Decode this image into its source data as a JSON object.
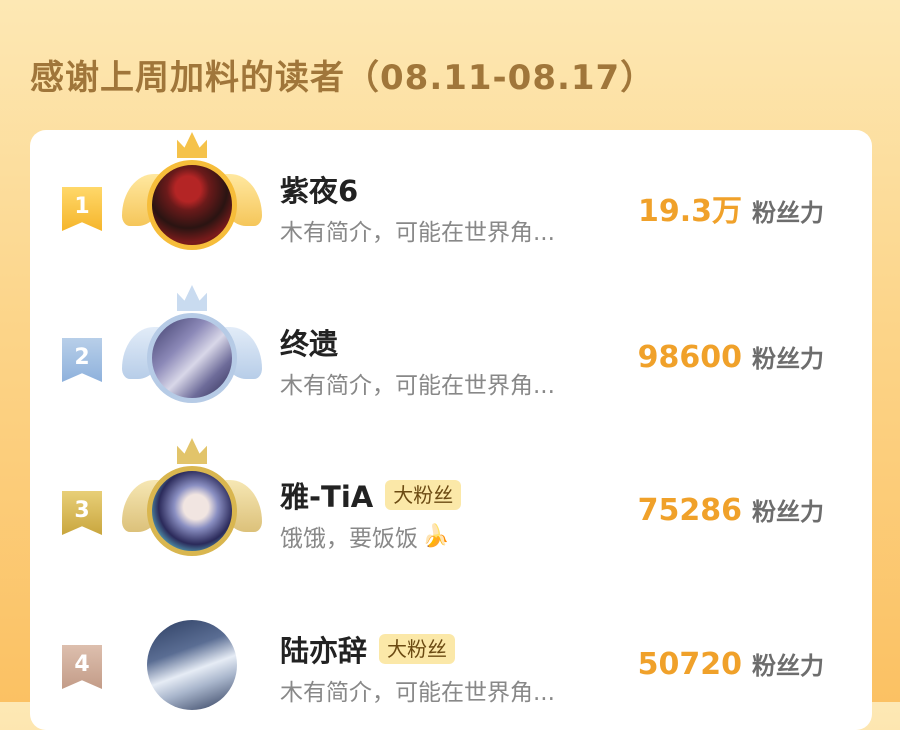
{
  "header": {
    "title": "感谢上周加料的读者（08.11-08.17）"
  },
  "colors": {
    "accent": "#f0a12a",
    "badge_bg": "#fbe8a8"
  },
  "readers": [
    {
      "rank": "1",
      "name": "紫夜6",
      "badge": "",
      "desc": "木有简介，可能在世界角...",
      "emoji": "",
      "score": "19.3万",
      "unit": "粉丝力"
    },
    {
      "rank": "2",
      "name": "终遗",
      "badge": "",
      "desc": "木有简介，可能在世界角...",
      "emoji": "",
      "score": "98600",
      "unit": "粉丝力"
    },
    {
      "rank": "3",
      "name": "雅-TiA",
      "badge": "大粉丝",
      "desc": "饿饿，要饭饭",
      "emoji": "🍌",
      "score": "75286",
      "unit": "粉丝力"
    },
    {
      "rank": "4",
      "name": "陆亦辞",
      "badge": "大粉丝",
      "desc": "木有简介，可能在世界角...",
      "emoji": "",
      "score": "50720",
      "unit": "粉丝力"
    }
  ]
}
